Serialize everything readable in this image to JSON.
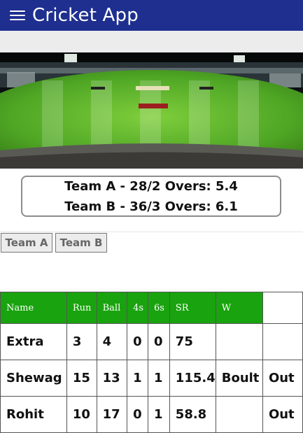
{
  "app": {
    "title": "Cricket App"
  },
  "score": {
    "team_a_line": "Team A - 28/2 Overs: 5.4",
    "team_b_line": "Team B - 36/3 Overs: 6.1"
  },
  "tabs": [
    {
      "label": "Team A"
    },
    {
      "label": "Team B"
    }
  ],
  "table": {
    "headers": [
      "Name",
      "Run",
      "Ball",
      "4s",
      "6s",
      "SR",
      "W",
      ""
    ],
    "rows": [
      [
        "Extra",
        "3",
        "4",
        "0",
        "0",
        "75",
        "",
        ""
      ],
      [
        "Shewag",
        "15",
        "13",
        "1",
        "1",
        "115.4",
        "Boult",
        "Out"
      ],
      [
        "Rohit",
        "10",
        "17",
        "0",
        "1",
        "58.8",
        "",
        "Out"
      ]
    ]
  },
  "colors": {
    "appbar": "#1f2f8f",
    "table_header": "#19a30e"
  }
}
